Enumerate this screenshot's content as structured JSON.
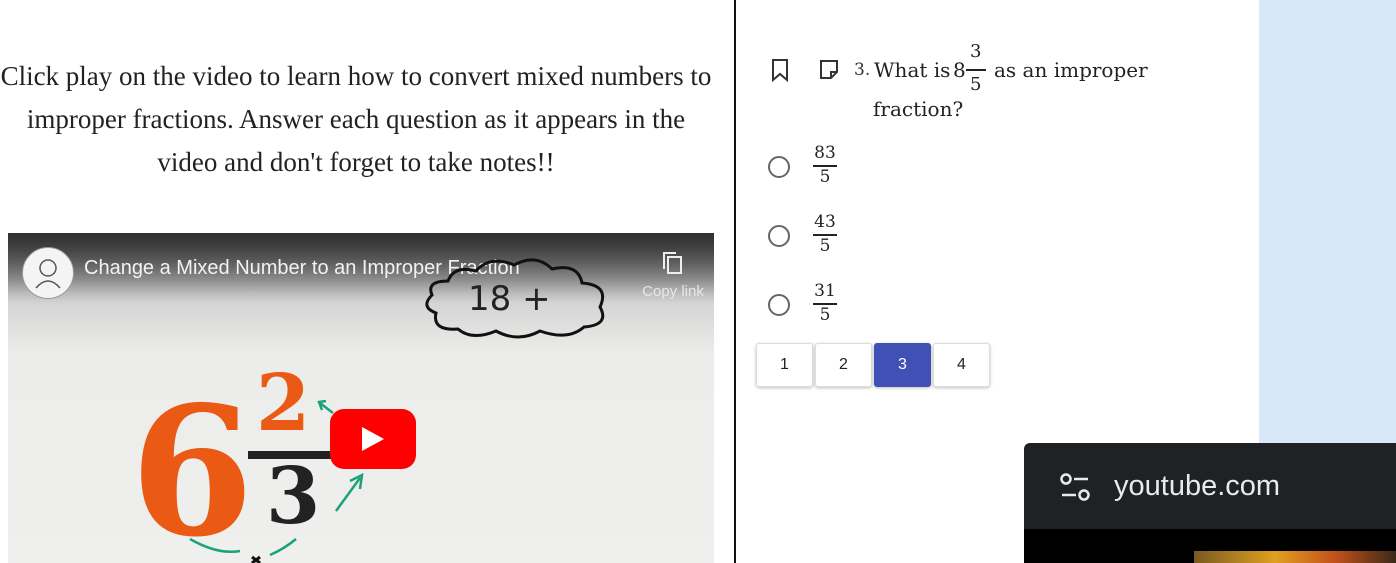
{
  "instructions": {
    "text": "Click play on the video to learn how to convert mixed numbers to improper fractions. Answer each question as it appears in the video and don't forget to take notes!!"
  },
  "video": {
    "title": "Change a Mixed Number to an Improper Fraction",
    "copy_link_label": "Copy link",
    "cloud_text": "18 +",
    "thumbnail": {
      "whole": "6",
      "numerator": "2",
      "denominator": "3"
    }
  },
  "question": {
    "number": "3.",
    "text_before": "What is",
    "mixed": {
      "whole": "8",
      "numerator": "3",
      "denominator": "5"
    },
    "text_after": "as an improper",
    "text_line2": "fraction?",
    "options": [
      {
        "numerator": "83",
        "denominator": "5"
      },
      {
        "numerator": "43",
        "denominator": "5"
      },
      {
        "numerator": "31",
        "denominator": "5"
      }
    ]
  },
  "pager": {
    "pages": [
      "1",
      "2",
      "3",
      "4"
    ],
    "active": "3"
  },
  "mini_player": {
    "site": "youtube.com"
  },
  "colors": {
    "accent": "#3f51b5",
    "play": "#ff0000",
    "orange": "#ea5a14",
    "side_panel": "#d9e8f8",
    "toast": "#202124"
  }
}
